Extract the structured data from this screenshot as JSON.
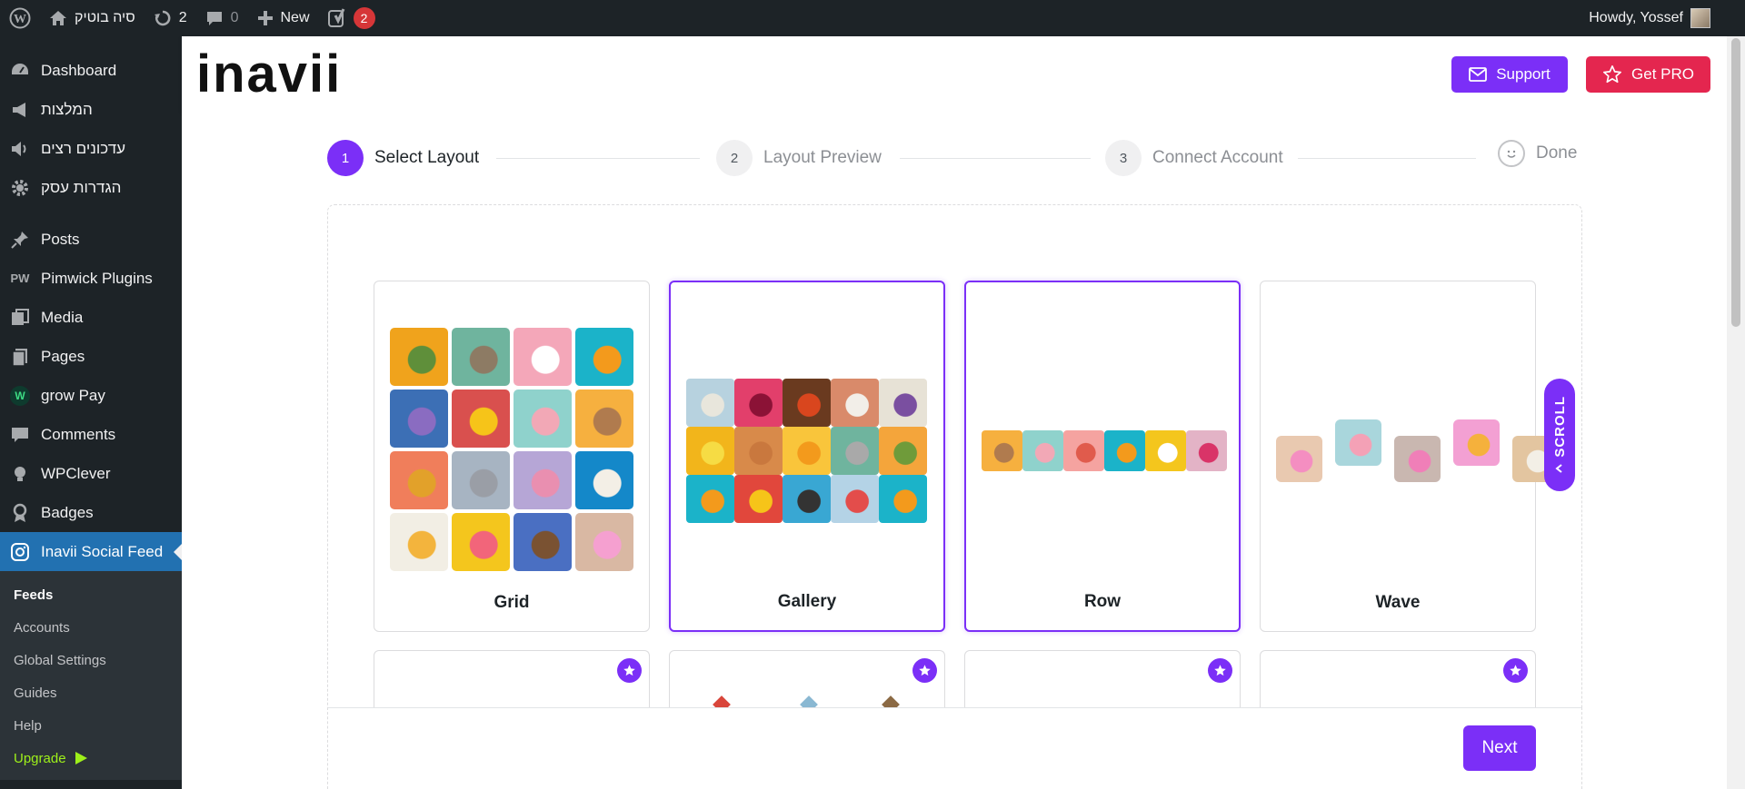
{
  "adminbar": {
    "site_name": "סיה בוטיק",
    "updates_count": "2",
    "comments_count": "0",
    "new_label": "New",
    "yoast_count": "2",
    "howdy": "Howdy, Yossef"
  },
  "sidebar": {
    "items": [
      {
        "label": "Dashboard",
        "icon": "dashboard-icon"
      },
      {
        "label": "המלצות",
        "icon": "megaphone-icon"
      },
      {
        "label": "עדכונים רצים",
        "icon": "speaker-icon"
      },
      {
        "label": "הגדרות עסק",
        "icon": "gear-icon"
      },
      {
        "label": "Posts",
        "icon": "pin-icon"
      },
      {
        "label": "Pimwick Plugins",
        "icon": "pw-icon"
      },
      {
        "label": "Media",
        "icon": "media-icon"
      },
      {
        "label": "Pages",
        "icon": "pages-icon"
      },
      {
        "label": "grow Pay",
        "icon": "grow-icon"
      },
      {
        "label": "Comments",
        "icon": "comment-icon"
      },
      {
        "label": "WPClever",
        "icon": "bulb-icon"
      },
      {
        "label": "Badges",
        "icon": "badge-icon"
      },
      {
        "label": "Inavii Social Feed",
        "icon": "instagram-icon"
      }
    ],
    "submenu": [
      "Feeds",
      "Accounts",
      "Global Settings",
      "Guides",
      "Help",
      "Upgrade"
    ]
  },
  "header": {
    "logo": "inavii",
    "support_label": "Support",
    "pro_label": "Get PRO"
  },
  "steps": [
    {
      "num": "1",
      "label": "Select Layout"
    },
    {
      "num": "2",
      "label": "Layout Preview"
    },
    {
      "num": "3",
      "label": "Connect Account"
    },
    {
      "label": "Done"
    }
  ],
  "layouts": [
    "Grid",
    "Gallery",
    "Row",
    "Wave"
  ],
  "scroll_label": "SCROLL",
  "next_label": "Next",
  "colors": {
    "accent": "#7b2ff7",
    "pro": "#e4264f",
    "wp_blue": "#2271b1"
  }
}
